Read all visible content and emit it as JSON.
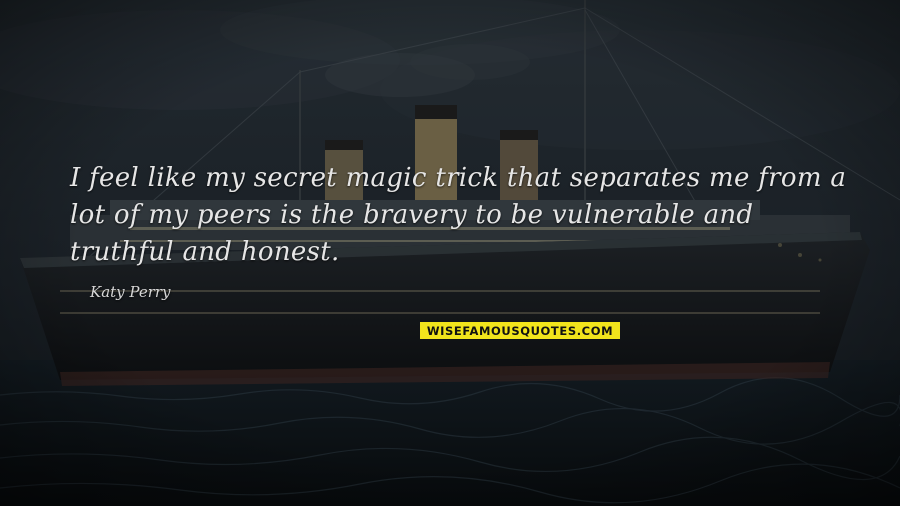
{
  "quote": {
    "text": "I feel like my secret magic trick that separates me from a lot of my peers is the bravery to be vulnerable and truthful and honest.",
    "author": "Katy Perry"
  },
  "watermark": {
    "text": "WISEFAMOUSQUOTES.COM",
    "color": "#f2e41c"
  },
  "scene": {
    "subject": "ship-at-night-image"
  }
}
